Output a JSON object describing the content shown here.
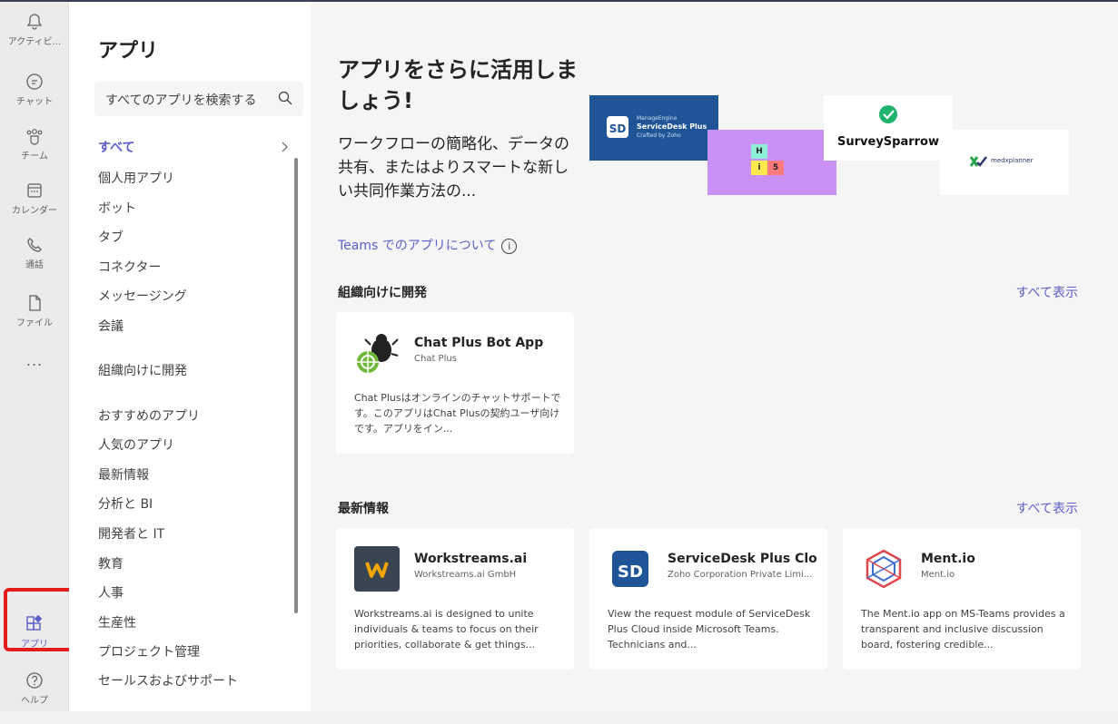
{
  "rail": {
    "activity": "アクティビ...",
    "chat": "チャット",
    "teams": "チーム",
    "calendar": "カレンダー",
    "calls": "通話",
    "files": "ファイル",
    "more": "...",
    "apps": "アプリ",
    "help": "ヘルプ"
  },
  "sidebar": {
    "title": "アプリ",
    "search_placeholder": "すべてのアプリを検索する",
    "categories": [
      "すべて",
      "個人用アプリ",
      "ボット",
      "タブ",
      "コネクター",
      "メッセージング",
      "会議",
      "組織向けに開発",
      "おすすめのアプリ",
      "人気のアプリ",
      "最新情報",
      "分析と BI",
      "開発者と IT",
      "教育",
      "人事",
      "生産性",
      "プロジェクト管理",
      "セールスおよびサポート"
    ]
  },
  "hero": {
    "title": "アプリをさらに活用しましょう!",
    "description": "ワークフローの簡略化、データの共有、またはよりスマートな新しい共同作業方法の...",
    "link": "Teams でのアプリについて",
    "info_glyph": "i",
    "tiles": {
      "servicedesk_brand": "ManageEngine",
      "servicedesk_product": "ServiceDesk Plus",
      "servicedesk_sub": "Crafted by Zoho",
      "his_letters": [
        "H",
        "i",
        "5"
      ],
      "surveysparrow": "SurveySparrow",
      "medxplanner": "medxplanner"
    }
  },
  "sections": {
    "org": {
      "heading": "組織向けに開発",
      "show_all": "すべて表示",
      "cards": [
        {
          "name": "Chat Plus Bot App",
          "publisher": "Chat Plus",
          "description": "Chat Plusはオンラインのチャットサポートです。このアプリはChat Plusの契約ユーザ向けです。アプリをイン..."
        }
      ]
    },
    "latest": {
      "heading": "最新情報",
      "show_all": "すべて表示",
      "cards": [
        {
          "name": "Workstreams.ai",
          "publisher": "Workstreams.ai GmbH",
          "description": "Workstreams.ai is designed to unite individuals & teams to focus on their priorities, collaborate & get things..."
        },
        {
          "name": "ServiceDesk Plus Clo...",
          "publisher": "Zoho Corporation Private Limi...",
          "description": "View the request module of ServiceDesk Plus Cloud inside Microsoft Teams. Technicians and..."
        },
        {
          "name": "Ment.io",
          "publisher": "Ment.io",
          "description": "The Ment.io app on MS-Teams provides a transparent and inclusive discussion board, fostering credible..."
        }
      ]
    }
  },
  "colors": {
    "accent": "#5b5fc7",
    "highlight_box": "#e21b1b",
    "his_tile": "#c991f5",
    "servicedesk_tile": "#1f5596"
  }
}
